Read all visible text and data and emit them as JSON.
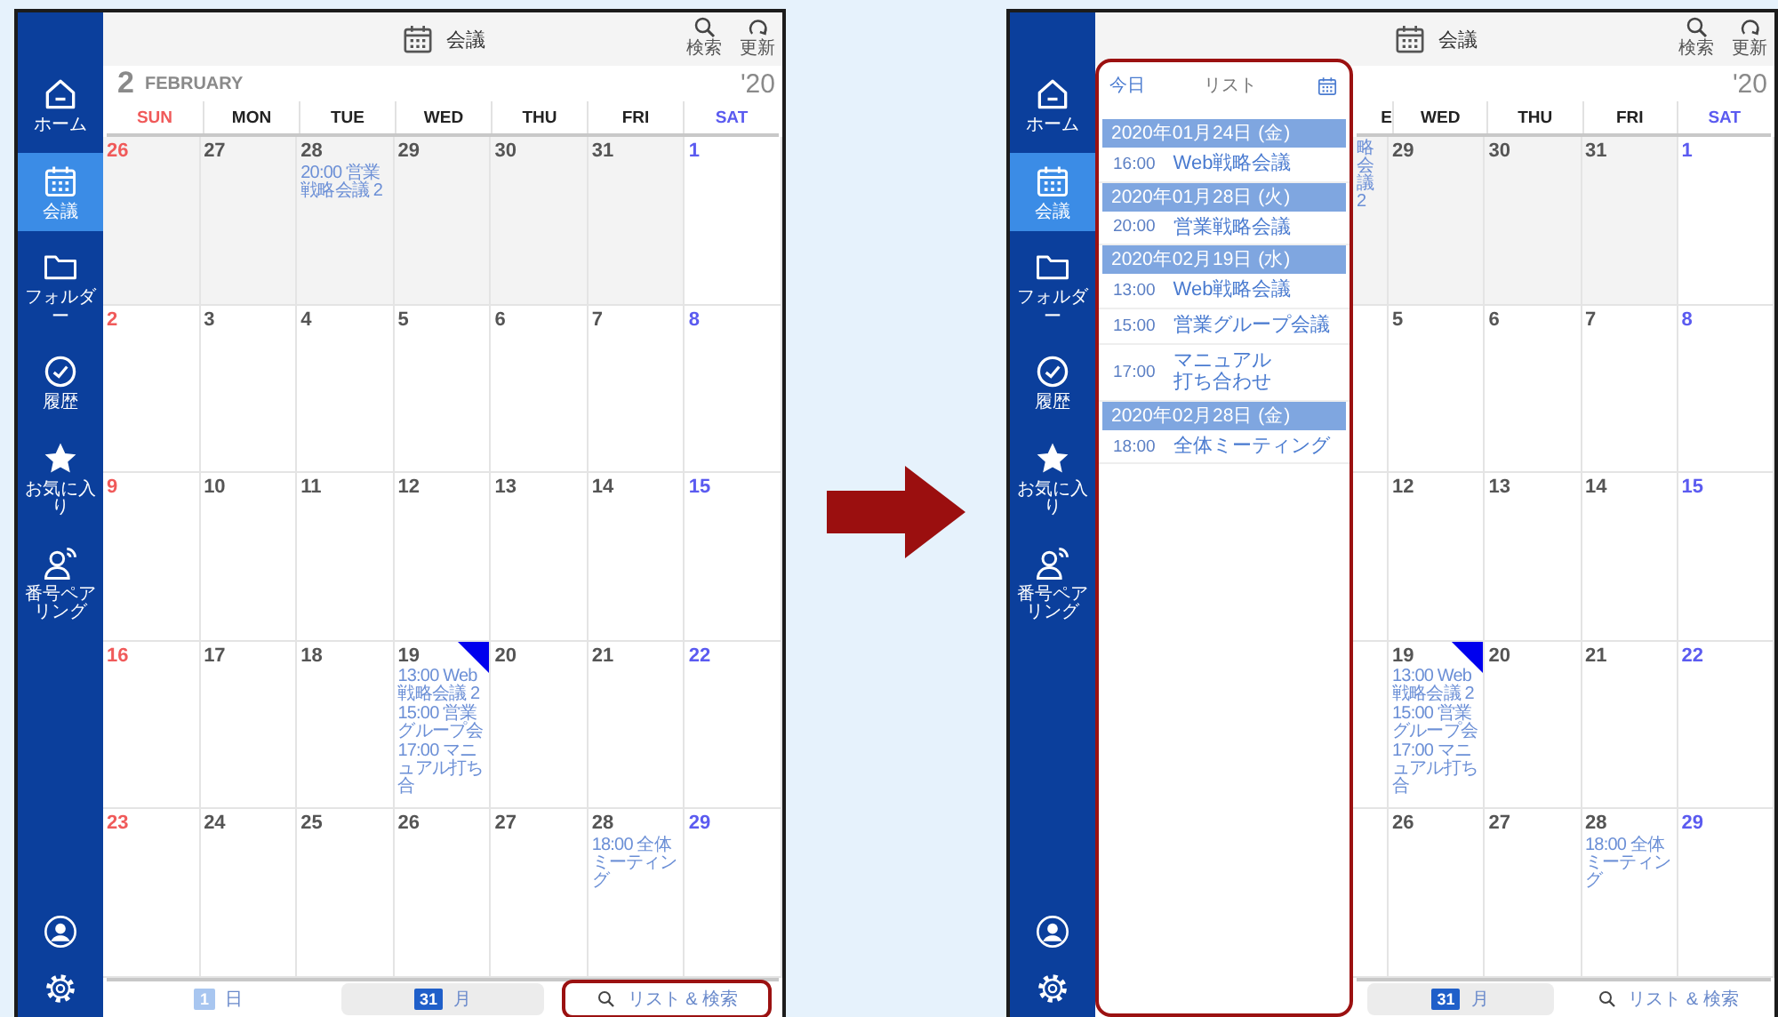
{
  "screens": [
    {
      "sidebar": {
        "items": [
          {
            "kind": "home",
            "label": "ホーム",
            "selected": false
          },
          {
            "kind": "calendar",
            "label": "会議",
            "selected": true
          },
          {
            "kind": "folder",
            "label": "フォルダー",
            "selected": false
          },
          {
            "kind": "history",
            "label": "履歴",
            "selected": false
          },
          {
            "kind": "star",
            "label": "お気に入り",
            "selected": false
          },
          {
            "kind": "pairing",
            "label": "番号ペアリング",
            "selected": false
          }
        ]
      },
      "header": {
        "title": "会議",
        "actions": [
          {
            "kind": "search",
            "label": "検索"
          },
          {
            "kind": "refresh",
            "label": "更新"
          }
        ]
      },
      "month": {
        "number": "2",
        "name": "FEBRUARY",
        "year": "'20"
      },
      "weekdays": [
        {
          "label": "SUN",
          "kind": "sun",
          "partial": false
        },
        {
          "label": "MON",
          "kind": "day",
          "partial": false
        },
        {
          "label": "TUE",
          "kind": "day",
          "partial": false
        },
        {
          "label": "WED",
          "kind": "day",
          "partial": false
        },
        {
          "label": "THU",
          "kind": "day",
          "partial": false
        },
        {
          "label": "FRI",
          "kind": "day",
          "partial": false
        },
        {
          "label": "SAT",
          "kind": "sat",
          "partial": false
        }
      ],
      "weeks": [
        [
          {
            "day": "26",
            "outside": true,
            "marked": false
          },
          {
            "day": "27",
            "outside": true,
            "marked": false
          },
          {
            "day": "28",
            "outside": true,
            "marked": false,
            "events": [
              "20:00 営業戦略会議 2"
            ]
          },
          {
            "day": "29",
            "outside": true,
            "marked": false
          },
          {
            "day": "30",
            "outside": true,
            "marked": false
          },
          {
            "day": "31",
            "outside": true,
            "marked": false
          },
          {
            "day": "1",
            "outside": false,
            "marked": false
          }
        ],
        [
          {
            "day": "2",
            "outside": false,
            "marked": false
          },
          {
            "day": "3",
            "outside": false,
            "marked": false
          },
          {
            "day": "4",
            "outside": false,
            "marked": false
          },
          {
            "day": "5",
            "outside": false,
            "marked": false
          },
          {
            "day": "6",
            "outside": false,
            "marked": false
          },
          {
            "day": "7",
            "outside": false,
            "marked": false
          },
          {
            "day": "8",
            "outside": false,
            "marked": false
          }
        ],
        [
          {
            "day": "9",
            "outside": false,
            "marked": false
          },
          {
            "day": "10",
            "outside": false,
            "marked": false
          },
          {
            "day": "11",
            "outside": false,
            "marked": false
          },
          {
            "day": "12",
            "outside": false,
            "marked": false
          },
          {
            "day": "13",
            "outside": false,
            "marked": false
          },
          {
            "day": "14",
            "outside": false,
            "marked": false
          },
          {
            "day": "15",
            "outside": false,
            "marked": false
          }
        ],
        [
          {
            "day": "16",
            "outside": false,
            "marked": false
          },
          {
            "day": "17",
            "outside": false,
            "marked": false
          },
          {
            "day": "18",
            "outside": false,
            "marked": false
          },
          {
            "day": "19",
            "outside": false,
            "marked": true,
            "events": [
              "13:00 Web戦略会議 2",
              "15:00 営業グループ会",
              "17:00 マニュアル打ち合"
            ]
          },
          {
            "day": "20",
            "outside": false,
            "marked": false
          },
          {
            "day": "21",
            "outside": false,
            "marked": false
          },
          {
            "day": "22",
            "outside": false,
            "marked": false
          }
        ],
        [
          {
            "day": "23",
            "outside": false,
            "marked": false
          },
          {
            "day": "24",
            "outside": false,
            "marked": false
          },
          {
            "day": "25",
            "outside": false,
            "marked": false
          },
          {
            "day": "26",
            "outside": false,
            "marked": false
          },
          {
            "day": "27",
            "outside": false,
            "marked": false
          },
          {
            "day": "28",
            "outside": false,
            "marked": false,
            "events": [
              "18:00 全体ミーティング"
            ]
          },
          {
            "day": "29",
            "outside": false,
            "marked": false
          }
        ]
      ],
      "bottom_tabs": [
        {
          "kind": "day",
          "icon_text": "1",
          "label": "日",
          "selected": false,
          "highlighted": false
        },
        {
          "kind": "month",
          "icon_text": "31",
          "label": "月",
          "selected": true,
          "highlighted": false
        },
        {
          "kind": "search",
          "label": "リスト & 検索",
          "selected": false,
          "highlighted": true
        }
      ]
    },
    {
      "sidebar": {
        "items": [
          {
            "kind": "home",
            "label": "ホーム",
            "selected": false
          },
          {
            "kind": "calendar",
            "label": "会議",
            "selected": true
          },
          {
            "kind": "folder",
            "label": "フォルダー",
            "selected": false
          },
          {
            "kind": "history",
            "label": "履歴",
            "selected": false
          },
          {
            "kind": "star",
            "label": "お気に入り",
            "selected": false
          },
          {
            "kind": "pairing",
            "label": "番号ペアリング",
            "selected": false
          }
        ]
      },
      "header": {
        "title": "会議",
        "actions": [
          {
            "kind": "search",
            "label": "検索"
          },
          {
            "kind": "refresh",
            "label": "更新"
          }
        ]
      },
      "list_panel": {
        "today": "今日",
        "title": "リスト",
        "highlighted": true,
        "groups": [
          {
            "date": "2020年01月24日 (金)",
            "items": [
              {
                "time": "16:00",
                "title": "Web戦略会議"
              }
            ]
          },
          {
            "date": "2020年01月28日 (火)",
            "items": [
              {
                "time": "20:00",
                "title": "営業戦略会議"
              }
            ]
          },
          {
            "date": "2020年02月19日 (水)",
            "items": [
              {
                "time": "13:00",
                "title": "Web戦略会議"
              },
              {
                "time": "15:00",
                "title": "営業グループ会議"
              },
              {
                "time": "17:00",
                "title": "マニュアル",
                "title_cont": "打ち合わせ"
              }
            ]
          },
          {
            "date": "2020年02月28日 (金)",
            "items": [
              {
                "time": "18:00",
                "title": "全体ミーティング"
              }
            ]
          }
        ]
      },
      "month": {
        "year": "'20"
      },
      "weekdays": [
        {
          "label": "E",
          "kind": "day",
          "partial": true
        },
        {
          "label": "WED",
          "kind": "day",
          "partial": false
        },
        {
          "label": "THU",
          "kind": "day",
          "partial": false
        },
        {
          "label": "FRI",
          "kind": "day",
          "partial": false
        },
        {
          "label": "SAT",
          "kind": "sat",
          "partial": false
        }
      ],
      "weeks": [
        [
          {
            "outside": true,
            "marked": false,
            "events": [
              "略会議 2"
            ]
          },
          {
            "day": "29",
            "outside": true,
            "marked": false
          },
          {
            "day": "30",
            "outside": true,
            "marked": false
          },
          {
            "day": "31",
            "outside": true,
            "marked": false
          },
          {
            "day": "1",
            "outside": false,
            "marked": false
          }
        ],
        [
          {
            "outside": false,
            "marked": false
          },
          {
            "day": "5",
            "outside": false,
            "marked": false
          },
          {
            "day": "6",
            "outside": false,
            "marked": false
          },
          {
            "day": "7",
            "outside": false,
            "marked": false
          },
          {
            "day": "8",
            "outside": false,
            "marked": false
          }
        ],
        [
          {
            "outside": false,
            "marked": false
          },
          {
            "day": "12",
            "outside": false,
            "marked": false
          },
          {
            "day": "13",
            "outside": false,
            "marked": false
          },
          {
            "day": "14",
            "outside": false,
            "marked": false
          },
          {
            "day": "15",
            "outside": false,
            "marked": false
          }
        ],
        [
          {
            "outside": false,
            "marked": false
          },
          {
            "day": "19",
            "outside": false,
            "marked": true,
            "events": [
              "13:00 Web戦略会議 2",
              "15:00 営業グループ会",
              "17:00 マニュアル打ち合"
            ]
          },
          {
            "day": "20",
            "outside": false,
            "marked": false
          },
          {
            "day": "21",
            "outside": false,
            "marked": false
          },
          {
            "day": "22",
            "outside": false,
            "marked": false
          }
        ],
        [
          {
            "outside": false,
            "marked": false
          },
          {
            "day": "26",
            "outside": false,
            "marked": false
          },
          {
            "day": "27",
            "outside": false,
            "marked": false
          },
          {
            "day": "28",
            "outside": false,
            "marked": false,
            "events": [
              "18:00 全体ミーティング"
            ]
          },
          {
            "day": "29",
            "outside": false,
            "marked": false
          }
        ]
      ],
      "bottom_tabs": [
        {
          "kind": "month",
          "icon_text": "31",
          "label": "月",
          "selected": true,
          "highlighted": false
        },
        {
          "kind": "search",
          "label": "リスト & 検索",
          "selected": false,
          "highlighted": false
        }
      ]
    }
  ]
}
